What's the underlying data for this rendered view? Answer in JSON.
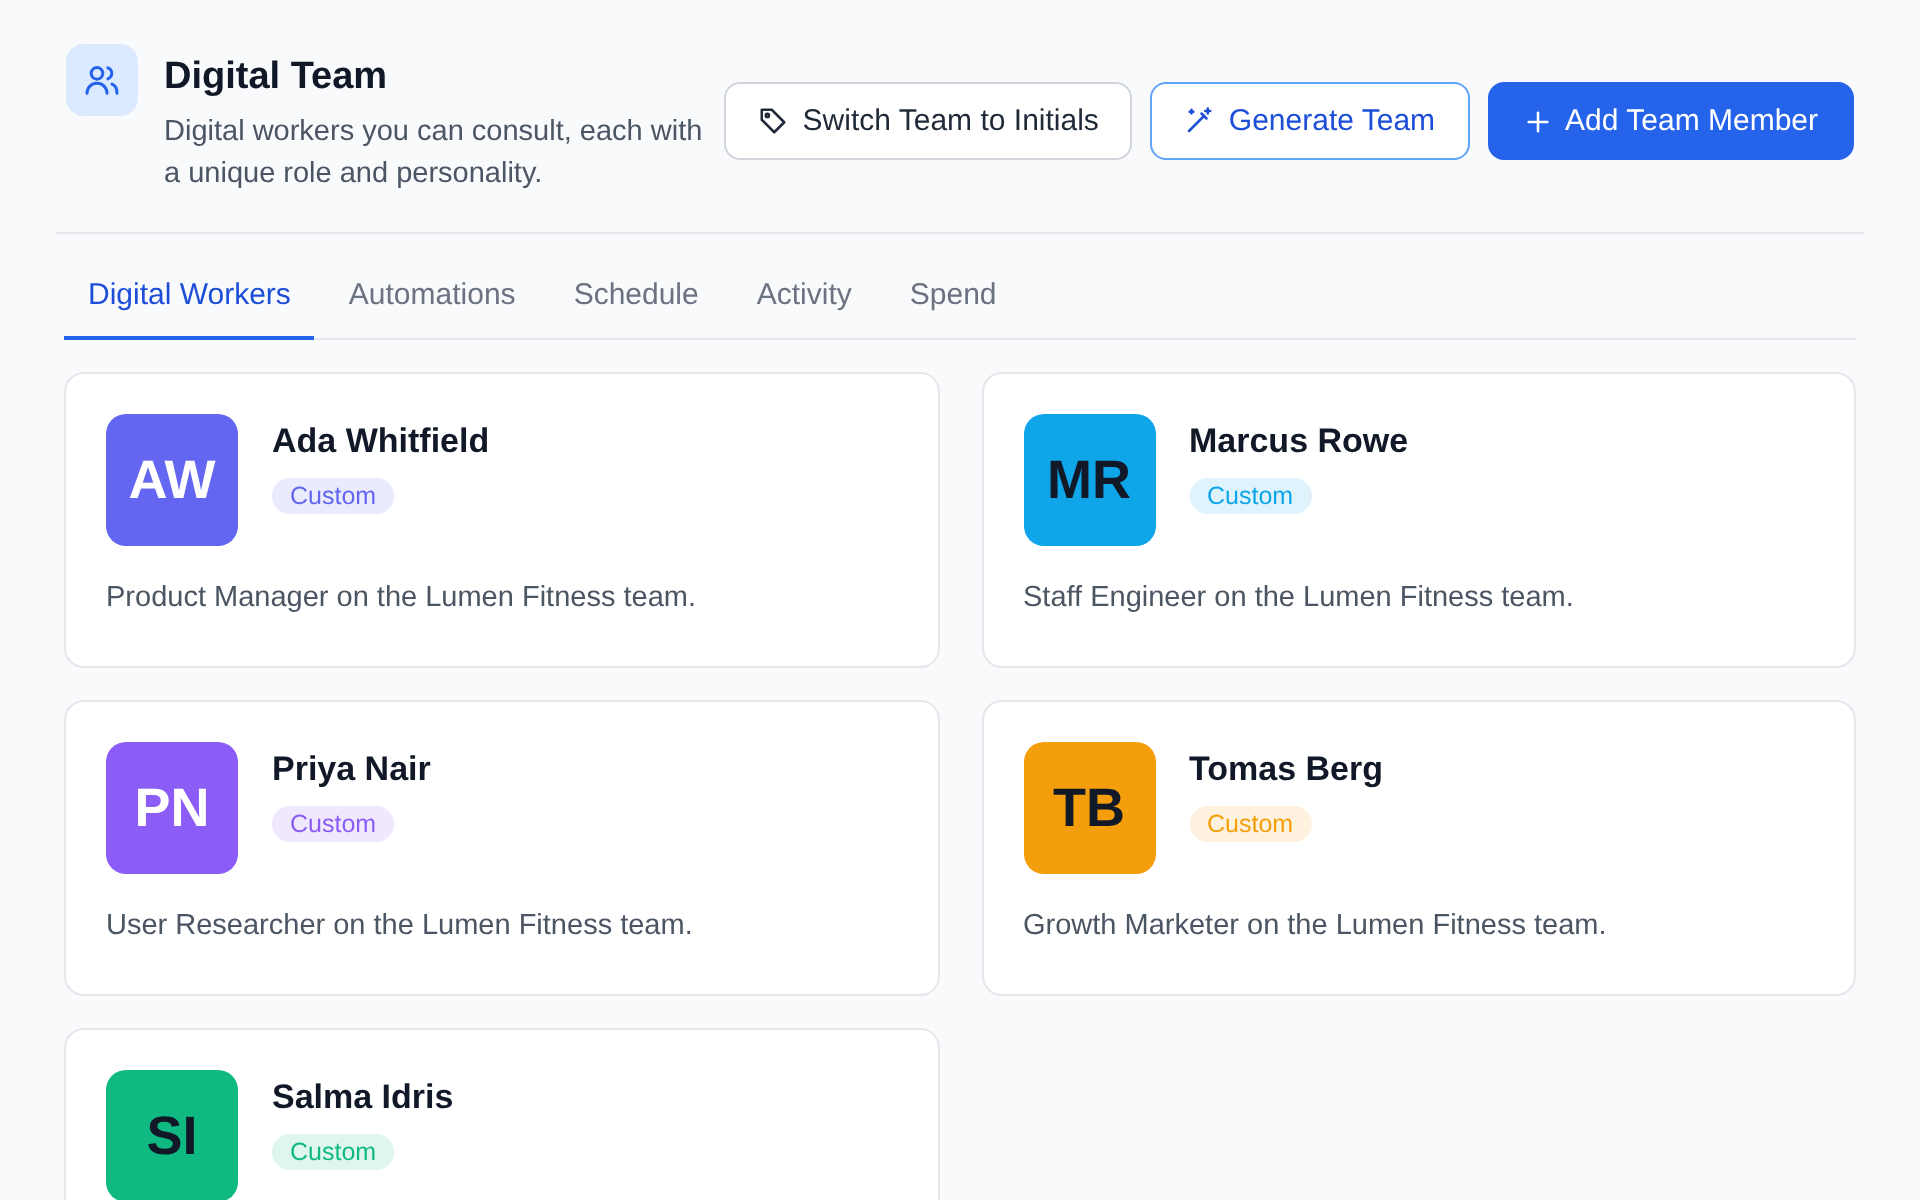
{
  "header": {
    "title": "Digital Team",
    "subtitle": "Digital workers you can consult, each with a unique role and personality."
  },
  "actions": [
    {
      "label": "Switch Team to Initials",
      "kind": "tag"
    },
    {
      "label": "Generate Team",
      "kind": "wand"
    },
    {
      "label": "Add Team Member",
      "kind": "plus"
    }
  ],
  "tabs": [
    {
      "label": "Digital Workers",
      "selected": true
    },
    {
      "label": "Automations",
      "selected": false
    },
    {
      "label": "Schedule",
      "selected": false
    },
    {
      "label": "Activity",
      "selected": false
    },
    {
      "label": "Spend",
      "selected": false
    }
  ],
  "workers": [
    {
      "initials": "AW",
      "name": "Ada Whitfield",
      "tag": "Custom",
      "color": "#6366f1",
      "description": "Product Manager on the Lumen Fitness team."
    },
    {
      "initials": "MR",
      "name": "Marcus Rowe",
      "tag": "Custom",
      "color": "#0ea5e9",
      "description": "Staff Engineer on the Lumen Fitness team."
    },
    {
      "initials": "PN",
      "name": "Priya Nair",
      "tag": "Custom",
      "color": "#8b5cf6",
      "description": "User Researcher on the Lumen Fitness team."
    },
    {
      "initials": "TB",
      "name": "Tomas Berg",
      "tag": "Custom",
      "color": "#f59e0b",
      "description": "Growth Marketer on the Lumen Fitness team."
    },
    {
      "initials": "SI",
      "name": "Salma Idris",
      "tag": "Custom",
      "color": "#10b981"
    }
  ]
}
